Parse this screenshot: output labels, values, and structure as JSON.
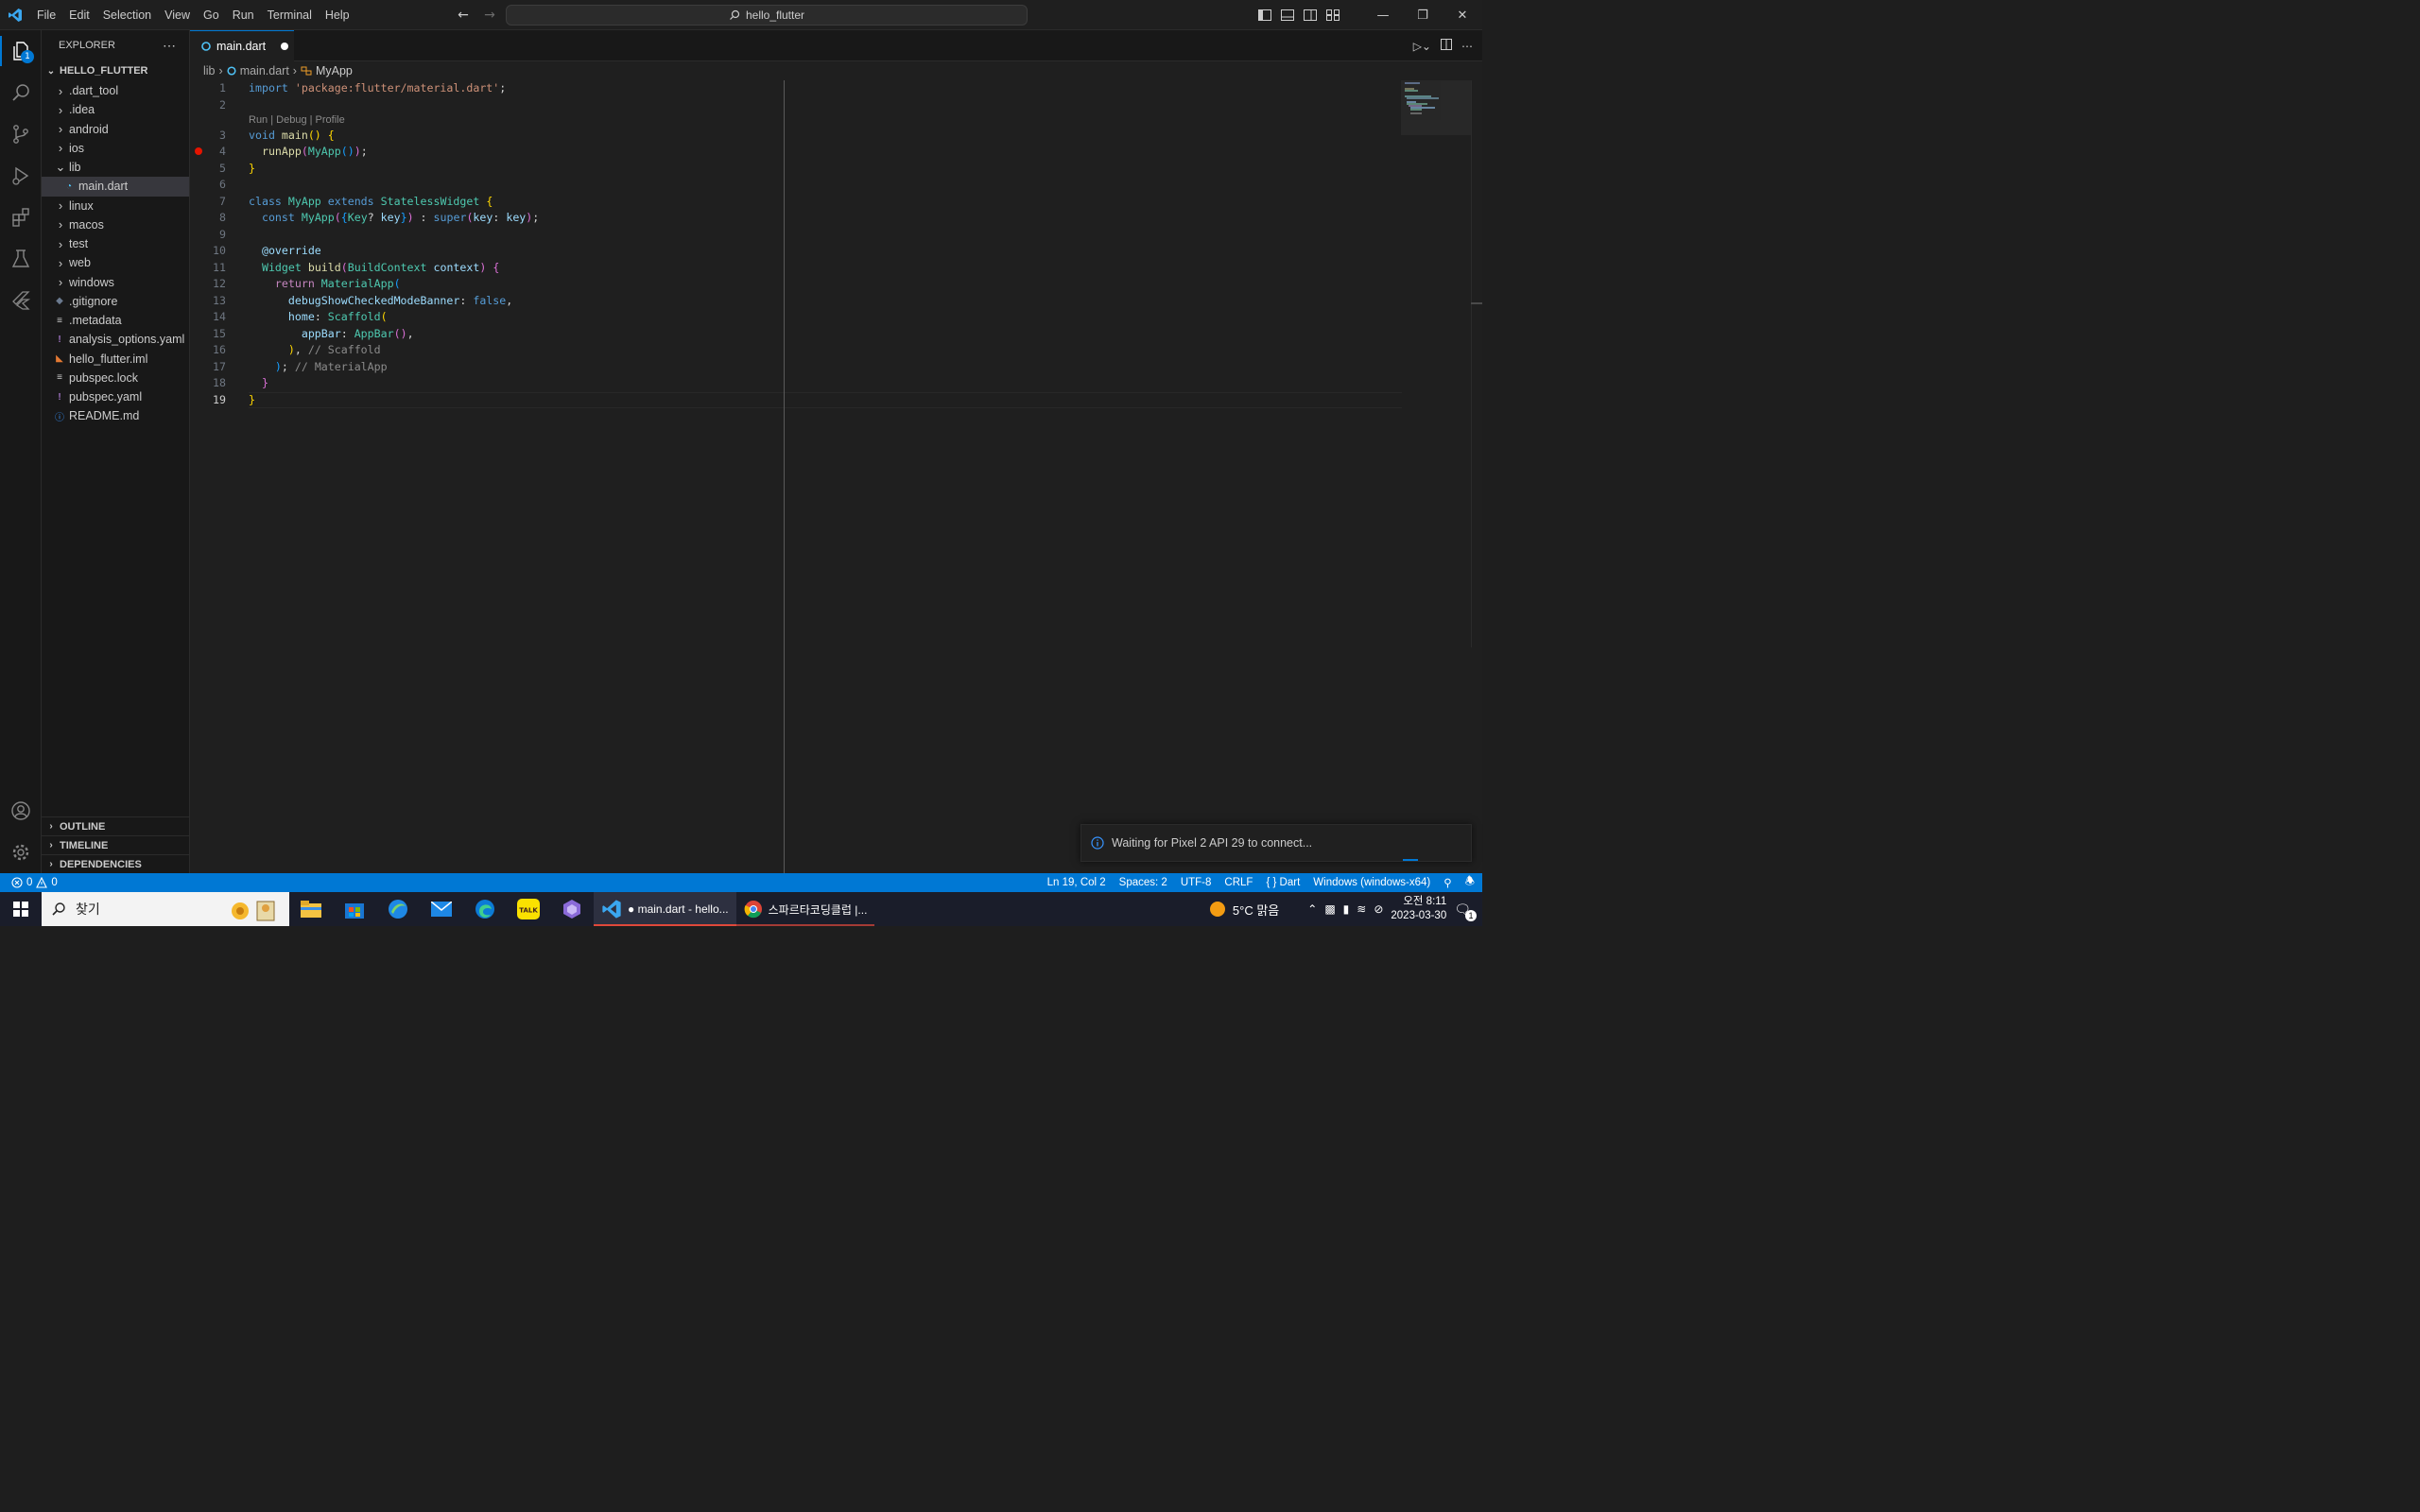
{
  "menu": [
    "File",
    "Edit",
    "Selection",
    "View",
    "Go",
    "Run",
    "Terminal",
    "Help"
  ],
  "command_center": "hello_flutter",
  "activity": {
    "explorer_badge": "1"
  },
  "sidebar": {
    "title": "EXPLORER",
    "root": "HELLO_FLUTTER",
    "items": [
      {
        "label": ".dart_tool",
        "type": "folder"
      },
      {
        "label": ".idea",
        "type": "folder"
      },
      {
        "label": "android",
        "type": "folder"
      },
      {
        "label": "ios",
        "type": "folder"
      },
      {
        "label": "lib",
        "type": "folder-open"
      },
      {
        "label": "main.dart",
        "type": "dart"
      },
      {
        "label": "linux",
        "type": "folder"
      },
      {
        "label": "macos",
        "type": "folder"
      },
      {
        "label": "test",
        "type": "folder"
      },
      {
        "label": "web",
        "type": "folder"
      },
      {
        "label": "windows",
        "type": "folder"
      },
      {
        "label": ".gitignore",
        "type": "git"
      },
      {
        "label": ".metadata",
        "type": "lines"
      },
      {
        "label": "analysis_options.yaml",
        "type": "yaml"
      },
      {
        "label": "hello_flutter.iml",
        "type": "rss"
      },
      {
        "label": "pubspec.lock",
        "type": "lines"
      },
      {
        "label": "pubspec.yaml",
        "type": "yaml"
      },
      {
        "label": "README.md",
        "type": "info"
      }
    ],
    "sections": [
      "OUTLINE",
      "TIMELINE",
      "DEPENDENCIES"
    ]
  },
  "tab": {
    "label": "main.dart"
  },
  "breadcrumb": {
    "seg1": "lib",
    "seg2": "main.dart",
    "seg3": "MyApp"
  },
  "codelens": "Run | Debug | Profile",
  "line_numbers": [
    "1",
    "2",
    "3",
    "4",
    "5",
    "6",
    "7",
    "8",
    "9",
    "10",
    "11",
    "12",
    "13",
    "14",
    "15",
    "16",
    "17",
    "18",
    "19"
  ],
  "code": {
    "l1_kw": "import",
    "l1_str": "'package:flutter/material.dart'",
    "l1_end": ";",
    "l3_kw": "void",
    "l3_fn": "main",
    "l3_p": "()",
    "l3_b": "{",
    "l4_fn": "runApp",
    "l4_p1": "(",
    "l4_ty": "MyApp",
    "l4_p2": "()",
    "l4_p3": ")",
    "l4_end": ";",
    "l5": "}",
    "l7_kw": "class",
    "l7_ty": "MyApp",
    "l7_kw2": "extends",
    "l7_ty2": "StatelessWidget",
    "l7_b": "{",
    "l8_kw": "const",
    "l8_ty": "MyApp",
    "l8_p1": "(",
    "l8_b1": "{",
    "l8_ty2": "Key",
    "l8_q": "?",
    "l8_var": "key",
    "l8_b2": "}",
    "l8_p2": ")",
    "l8_colon": " : ",
    "l8_kw2": "super",
    "l8_p3": "(",
    "l8_var2": "key",
    "l8_c": ": ",
    "l8_var3": "key",
    "l8_p4": ")",
    "l8_end": ";",
    "l10": "@override",
    "l11_ty": "Widget",
    "l11_fn": "build",
    "l11_p1": "(",
    "l11_ty2": "BuildContext",
    "l11_var": "context",
    "l11_p2": ")",
    "l11_b": "{",
    "l12_kw": "return",
    "l12_ty": "MaterialApp",
    "l12_p": "(",
    "l13_var": "debugShowCheckedModeBanner",
    "l13_c": ": ",
    "l13_kw": "false",
    "l13_end": ",",
    "l14_var": "home",
    "l14_c": ": ",
    "l14_ty": "Scaffold",
    "l14_p": "(",
    "l15_var": "appBar",
    "l15_c": ": ",
    "l15_ty": "AppBar",
    "l15_p": "()",
    "l15_end": ",",
    "l16_p": ")",
    "l16_end": ",",
    "l16_cm": "// Scaffold",
    "l17_p": ")",
    "l17_end": ";",
    "l17_cm": "// MaterialApp",
    "l18": "}",
    "l19": "}"
  },
  "notification": "Waiting for Pixel 2 API 29 to connect...",
  "status": {
    "errors": "0",
    "warnings": "0",
    "position": "Ln 19, Col 2",
    "spaces": "Spaces: 2",
    "encoding": "UTF-8",
    "eol": "CRLF",
    "language": "Dart",
    "device": "Windows (windows-x64)"
  },
  "taskbar": {
    "search": "찾기",
    "vscode_window": "● main.dart - hello...",
    "chrome_window": "스파르타코딩클럽 |...",
    "weather": "5°C 맑음",
    "time": "오전 8:11",
    "date": "2023-03-30",
    "notif_count": "1"
  },
  "colors": {
    "accent": "#0078d4",
    "statusbar": "#0078d4",
    "breakpoint": "#e51400"
  }
}
